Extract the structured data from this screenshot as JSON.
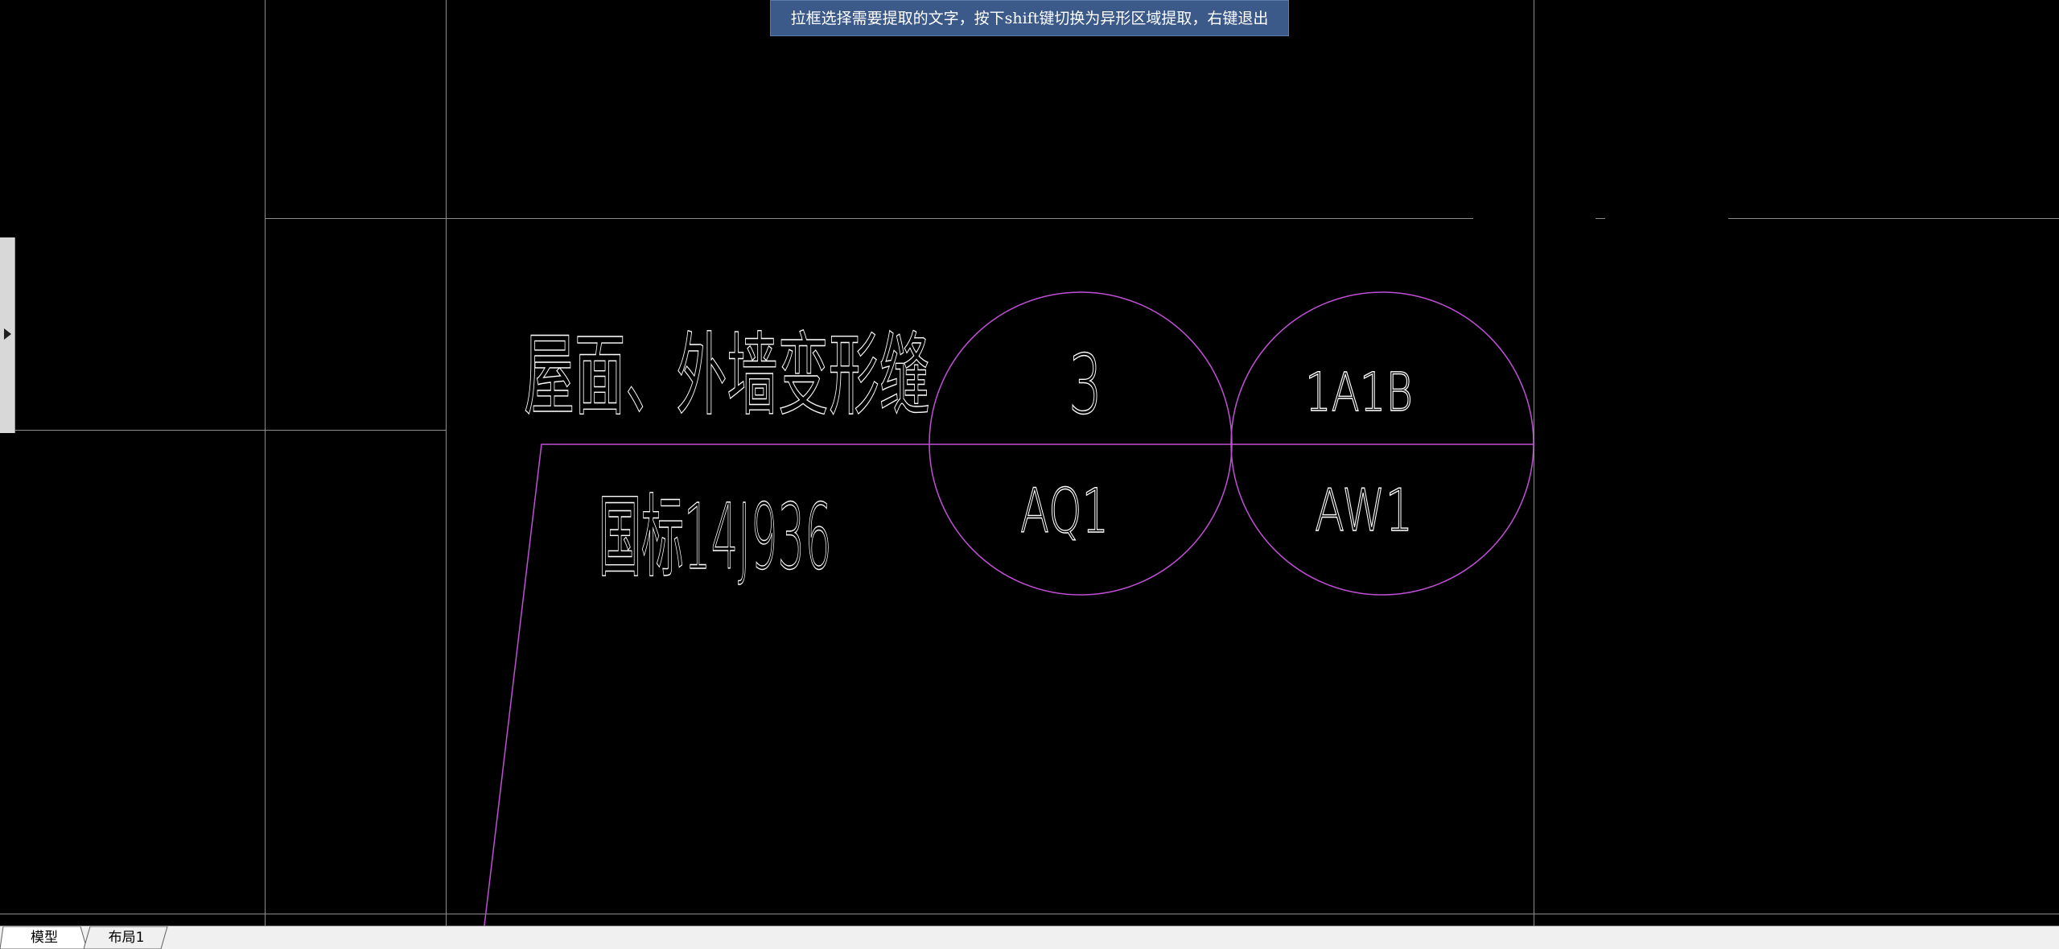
{
  "prompt": {
    "text": "拉框选择需要提取的文字，按下shift键切换为异形区域提取，右键退出"
  },
  "drawing": {
    "colors": {
      "background": "#000000",
      "grid_line": "#8c8c8c",
      "magenta": "#c04fd6",
      "text": "#ffffff"
    },
    "labels": {
      "title": "屋面、外墙变形缝",
      "standard": "国标14J936",
      "circle1_top": "3",
      "circle1_bottom": "AQ1",
      "circle2_top": "1A1B",
      "circle2_bottom": "AW1"
    }
  },
  "side_panel": {
    "toggle_icon": "caret-right-icon"
  },
  "tabs": [
    {
      "label": "模型",
      "active": true
    },
    {
      "label": "布局1",
      "active": false
    }
  ]
}
